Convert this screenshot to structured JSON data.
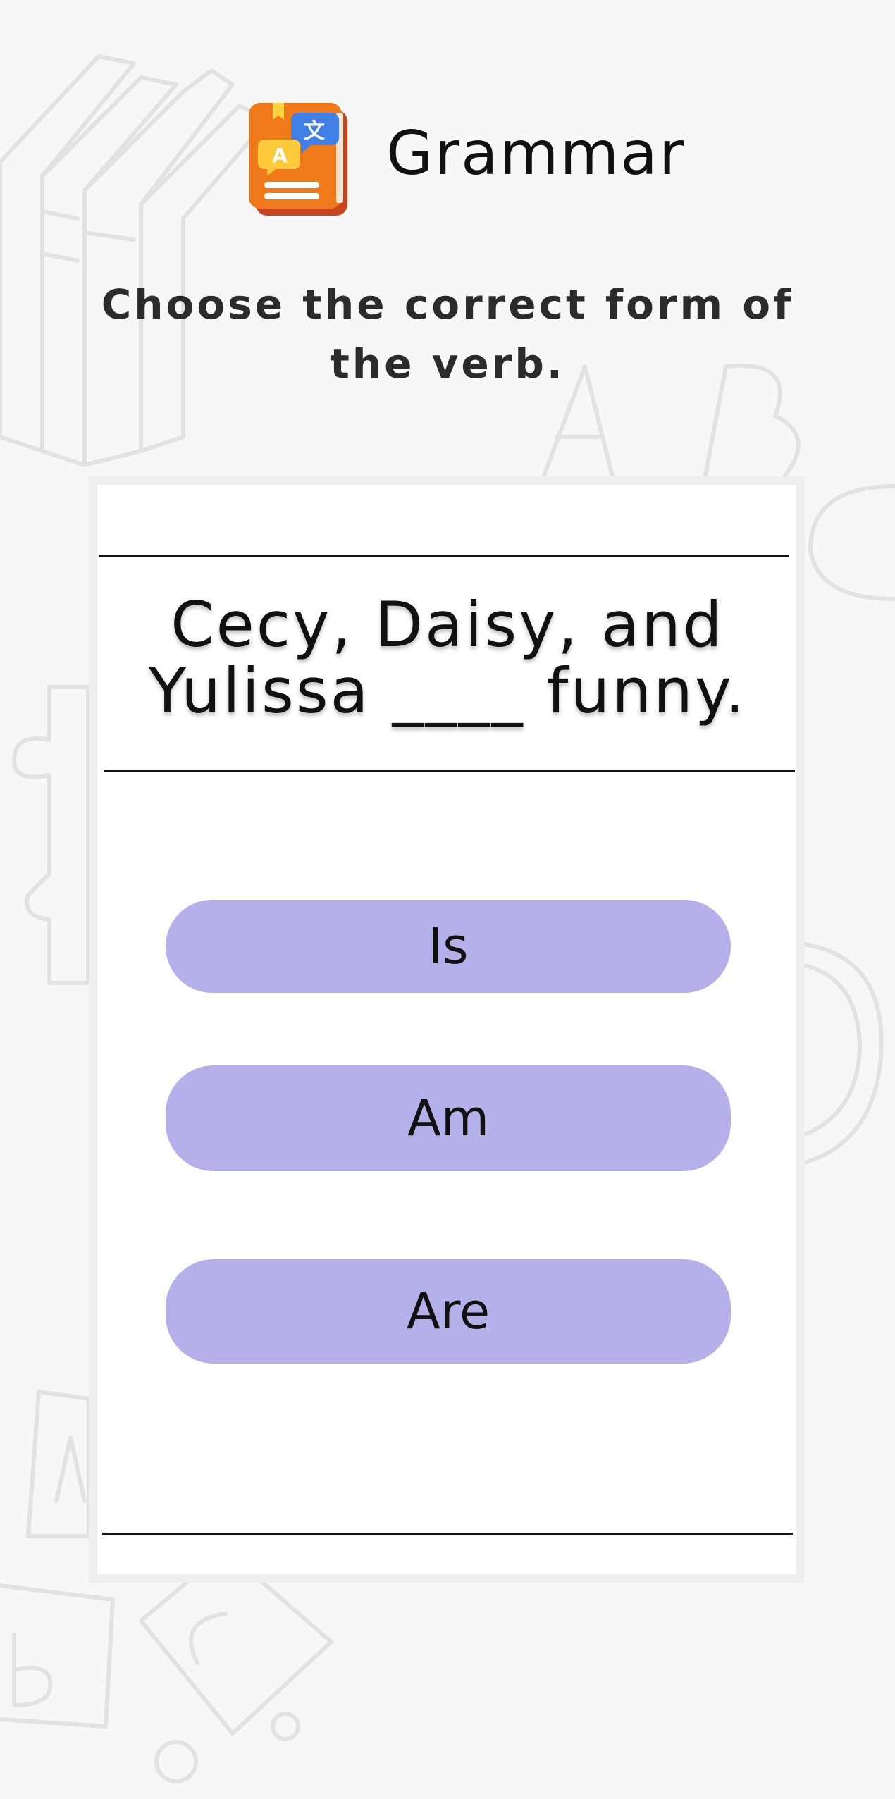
{
  "header": {
    "title": "Grammar",
    "icon": "grammar-book-icon"
  },
  "instruction": "Choose the correct form of the verb.",
  "question": {
    "text": "Cecy, Daisy, and Yulissa ____ funny."
  },
  "options": [
    {
      "label": "Is"
    },
    {
      "label": "Am"
    },
    {
      "label": "Are"
    }
  ],
  "colors": {
    "background": "#f7f7f7",
    "option_fill": "#b5b0ea",
    "icon_orange": "#f07a1a",
    "icon_blue": "#3f7fe6"
  }
}
